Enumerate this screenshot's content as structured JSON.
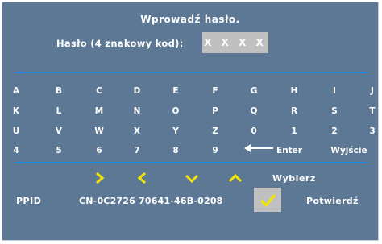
{
  "dialog": {
    "title": "Wprowadź hasło.",
    "password_label": "Hasło (4 znakowy kod):",
    "password_value": "X X X X"
  },
  "keyboard": {
    "row1": [
      "A",
      "B",
      "C",
      "D",
      "E",
      "F",
      "G",
      "H",
      "I",
      "J"
    ],
    "row2": [
      "K",
      "L",
      "M",
      "N",
      "O",
      "P",
      "Q",
      "R",
      "S",
      "T"
    ],
    "row3": [
      "U",
      "V",
      "W",
      "X",
      "Y",
      "Z",
      "0",
      "1",
      "2",
      "3"
    ],
    "row4": [
      "4",
      "5",
      "6",
      "7",
      "8",
      "9"
    ],
    "backspace_icon": "left-arrow-icon",
    "enter_label": "Enter",
    "exit_label": "Wyjście"
  },
  "footer": {
    "nav_icons": [
      "chevron-right-icon",
      "chevron-left-icon",
      "chevron-down-icon",
      "chevron-up-icon"
    ],
    "select_hint": "Wybierz",
    "ppid_label": "PPID",
    "ppid_value": "CN-0C2726 70641-46B-0208",
    "confirm_icon": "checkmark-icon",
    "confirm_label": "Potwierdź"
  },
  "colors": {
    "panel": "#5d7894",
    "rule": "#1a8ce0",
    "chevron": "#f2e600",
    "input_box": "#c0c0c0"
  }
}
